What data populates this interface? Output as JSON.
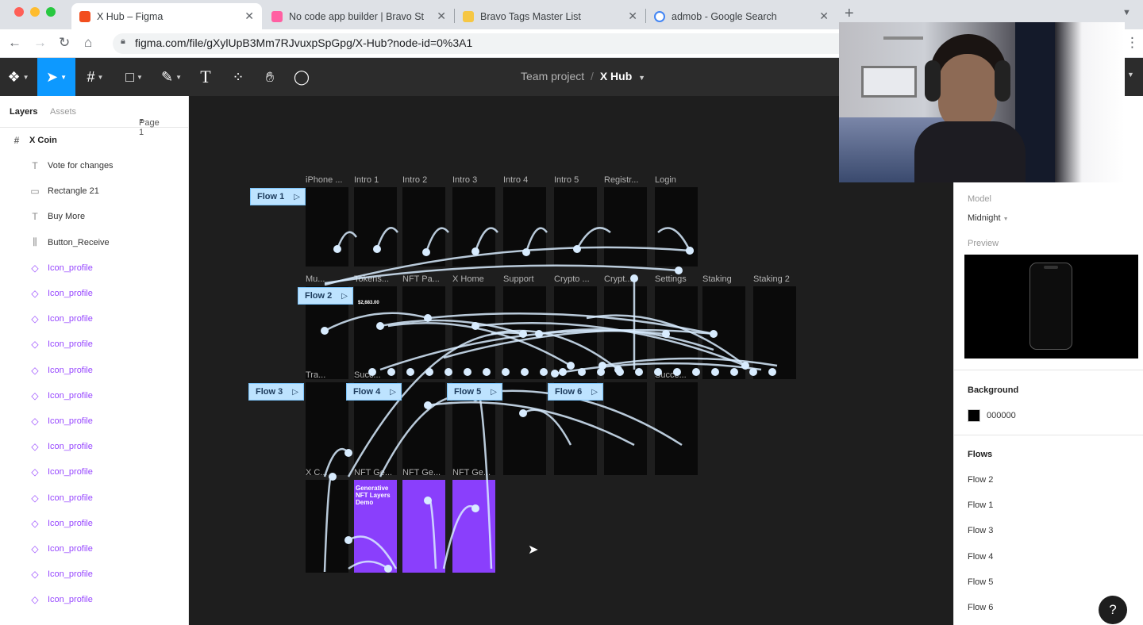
{
  "browser": {
    "tabs": [
      {
        "title": "X Hub – Figma",
        "active": true,
        "favicon": "figma-icon",
        "color": "#f24e1e"
      },
      {
        "title": "No code app builder | Bravo St",
        "active": false,
        "favicon": "bravo-icon",
        "color": "#ff5fa2"
      },
      {
        "title": "Bravo Tags Master List",
        "active": false,
        "favicon": "notes-icon",
        "color": "#f6c744"
      },
      {
        "title": "admob - Google Search",
        "active": false,
        "favicon": "google-icon",
        "color": "#4285f4"
      }
    ],
    "url": "figma.com/file/gXylUpB3Mm7RJvuxpSpGpg/X-Hub?node-id=0%3A1"
  },
  "toolbar": {
    "breadcrumb_team": "Team project",
    "breadcrumb_sep": "/",
    "file_name": "X Hub"
  },
  "layers_panel": {
    "tab_layers": "Layers",
    "tab_assets": "Assets",
    "page_selector": "Page 1",
    "root": "X Coin",
    "items": [
      {
        "label": "Vote for changes",
        "icon": "text-icon",
        "component": false
      },
      {
        "label": "Rectangle 21",
        "icon": "rectangle-icon",
        "component": false
      },
      {
        "label": "Buy More",
        "icon": "text-icon",
        "component": false
      },
      {
        "label": "Button_Receive",
        "icon": "layout-icon",
        "component": false
      },
      {
        "label": "Icon_profile",
        "icon": "component-icon",
        "component": true
      },
      {
        "label": "Icon_profile",
        "icon": "component-icon",
        "component": true
      },
      {
        "label": "Icon_profile",
        "icon": "component-icon",
        "component": true
      },
      {
        "label": "Icon_profile",
        "icon": "component-icon",
        "component": true
      },
      {
        "label": "Icon_profile",
        "icon": "component-icon",
        "component": true
      },
      {
        "label": "Icon_profile",
        "icon": "component-icon",
        "component": true
      },
      {
        "label": "Icon_profile",
        "icon": "component-icon",
        "component": true
      },
      {
        "label": "Icon_profile",
        "icon": "component-icon",
        "component": true
      },
      {
        "label": "Icon_profile",
        "icon": "component-icon",
        "component": true
      },
      {
        "label": "Icon_profile",
        "icon": "component-icon",
        "component": true
      },
      {
        "label": "Icon_profile",
        "icon": "component-icon",
        "component": true
      },
      {
        "label": "Icon_profile",
        "icon": "component-icon",
        "component": true
      },
      {
        "label": "Icon_profile",
        "icon": "component-icon",
        "component": true
      },
      {
        "label": "Icon_profile",
        "icon": "component-icon",
        "component": true
      }
    ]
  },
  "canvas": {
    "rows": [
      [
        "iPhone ...",
        "Intro 1",
        "Intro 2",
        "Intro 3",
        "Intro 4",
        "Intro 5",
        "Registr...",
        "Login"
      ],
      [
        "Mu...",
        "Tokens...",
        "NFT Pa...",
        "X Home",
        "Support",
        "Crypto ...",
        "Crypt...",
        "Settings",
        "Staking",
        "Staking 2"
      ],
      [
        "Tra...",
        "Succ...",
        "",
        "",
        "",
        "",
        "",
        "Succe..."
      ],
      [
        "X C...",
        "NFT Ge...",
        "NFT Ge...",
        "NFT Ge..."
      ]
    ],
    "flows": [
      "Flow 1",
      "Flow 2",
      "Flow 3",
      "Flow 4",
      "Flow 5",
      "Flow 6"
    ],
    "nft_title": "Generative NFT Layers Demo",
    "token_amount": "$2,683.00"
  },
  "right_panel": {
    "model_label": "Model",
    "model_value": "Midnight",
    "preview_label": "Preview",
    "background_label": "Background",
    "background_hex": "000000",
    "flows_label": "Flows",
    "flows": [
      "Flow 2",
      "Flow 1",
      "Flow 3",
      "Flow 4",
      "Flow 5",
      "Flow 6"
    ],
    "help": "?"
  },
  "colors": {
    "accent": "#0d99ff",
    "flow_badge": "#bde3ff",
    "component": "#9747ff",
    "connector": "#d8ecff"
  }
}
